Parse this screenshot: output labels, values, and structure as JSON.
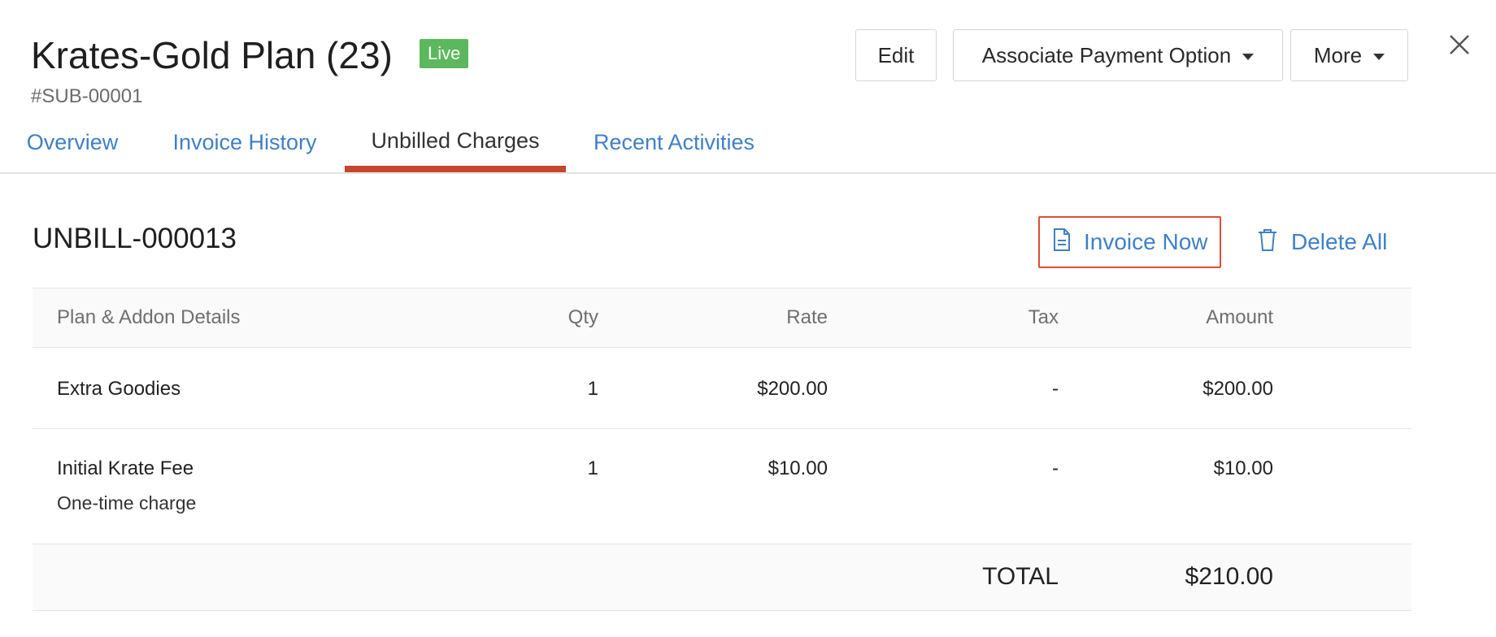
{
  "header": {
    "title": "Krates-Gold Plan (23)",
    "status_badge": "Live",
    "subscription_id": "#SUB-00001",
    "buttons": {
      "edit": "Edit",
      "associate_payment": "Associate Payment Option",
      "more": "More"
    },
    "close_icon": "close-icon"
  },
  "tabs": [
    {
      "label": "Overview",
      "active": false
    },
    {
      "label": "Invoice History",
      "active": false
    },
    {
      "label": "Unbilled Charges",
      "active": true
    },
    {
      "label": "Recent Activities",
      "active": false
    }
  ],
  "unbilled": {
    "id": "UNBILL-000013",
    "actions": {
      "invoice_now": "Invoice Now",
      "delete_all": "Delete All"
    },
    "columns": {
      "details": "Plan & Addon Details",
      "qty": "Qty",
      "rate": "Rate",
      "tax": "Tax",
      "amount": "Amount"
    },
    "rows": [
      {
        "name": "Extra Goodies",
        "note": "",
        "qty": "1",
        "rate": "$200.00",
        "tax": "-",
        "amount": "$200.00"
      },
      {
        "name": "Initial Krate Fee",
        "note": "One-time charge",
        "qty": "1",
        "rate": "$10.00",
        "tax": "-",
        "amount": "$10.00"
      }
    ],
    "total_label": "TOTAL",
    "total_value": "$210.00"
  },
  "colors": {
    "link_blue": "#3f80c7",
    "live_green": "#5cb85c",
    "active_tab_underline": "#c8452f",
    "highlight_border": "#e24c33"
  }
}
